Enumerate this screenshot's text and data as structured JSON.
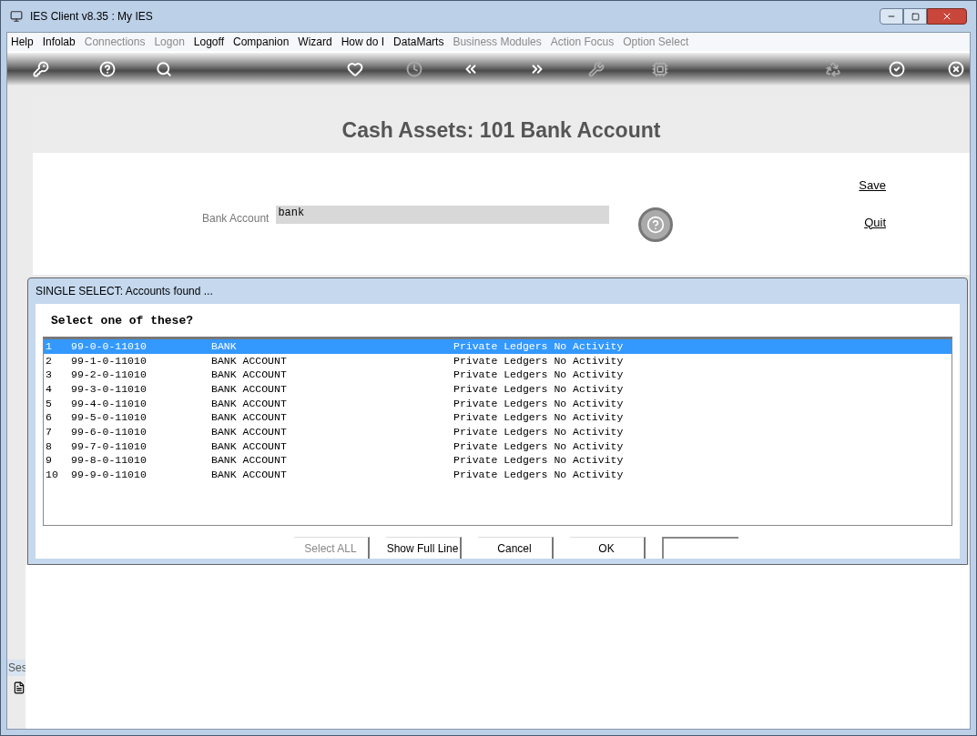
{
  "window": {
    "title": "IES Client v8.35 : My IES"
  },
  "menu": [
    {
      "label": "Help",
      "disabled": false
    },
    {
      "label": "Infolab",
      "disabled": false
    },
    {
      "label": "Connections",
      "disabled": true
    },
    {
      "label": "Logon",
      "disabled": true
    },
    {
      "label": "Logoff",
      "disabled": false
    },
    {
      "label": "Companion",
      "disabled": false
    },
    {
      "label": "Wizard",
      "disabled": false
    },
    {
      "label": "How do I",
      "disabled": false
    },
    {
      "label": "DataMarts",
      "disabled": false
    },
    {
      "label": "Business Modules",
      "disabled": true
    },
    {
      "label": "Action Focus",
      "disabled": true
    },
    {
      "label": "Option Select",
      "disabled": true
    }
  ],
  "toolbar": [
    {
      "kind": "key",
      "disabled": false
    },
    {
      "kind": "help",
      "disabled": false
    },
    {
      "kind": "search",
      "disabled": false
    },
    {
      "kind": "heart",
      "disabled": false
    },
    {
      "kind": "clock",
      "disabled": true
    },
    {
      "kind": "back",
      "disabled": false
    },
    {
      "kind": "forward",
      "disabled": false
    },
    {
      "kind": "tools",
      "disabled": true
    },
    {
      "kind": "chip",
      "disabled": true
    },
    {
      "kind": "recycle",
      "disabled": true
    },
    {
      "kind": "check",
      "disabled": false
    },
    {
      "kind": "close",
      "disabled": false
    }
  ],
  "form": {
    "title": "Cash Assets: 101 Bank Account",
    "field_label": "Bank Account",
    "field_value": "bank",
    "links": [
      "Save",
      "Quit"
    ]
  },
  "dialog": {
    "title": "SINGLE SELECT: Accounts found  ...",
    "prompt": "Select one of these?",
    "rows": [
      {
        "num": "1",
        "code": "99-0-0-11010",
        "name": "BANK",
        "status": "Private Ledgers No Activity",
        "selected": true
      },
      {
        "num": "2",
        "code": "99-1-0-11010",
        "name": "BANK ACCOUNT",
        "status": "Private Ledgers No Activity",
        "selected": false
      },
      {
        "num": "3",
        "code": "99-2-0-11010",
        "name": "BANK ACCOUNT",
        "status": "Private Ledgers No Activity",
        "selected": false
      },
      {
        "num": "4",
        "code": "99-3-0-11010",
        "name": "BANK ACCOUNT",
        "status": "Private Ledgers No Activity",
        "selected": false
      },
      {
        "num": "5",
        "code": "99-4-0-11010",
        "name": "BANK ACCOUNT",
        "status": "Private Ledgers No Activity",
        "selected": false
      },
      {
        "num": "6",
        "code": "99-5-0-11010",
        "name": "BANK ACCOUNT",
        "status": "Private Ledgers No Activity",
        "selected": false
      },
      {
        "num": "7",
        "code": "99-6-0-11010",
        "name": "BANK ACCOUNT",
        "status": "Private Ledgers No Activity",
        "selected": false
      },
      {
        "num": "8",
        "code": "99-7-0-11010",
        "name": "BANK ACCOUNT",
        "status": "Private Ledgers No Activity",
        "selected": false
      },
      {
        "num": "9",
        "code": "99-8-0-11010",
        "name": "BANK ACCOUNT",
        "status": "Private Ledgers No Activity",
        "selected": false
      },
      {
        "num": "10",
        "code": "99-9-0-11010",
        "name": "BANK ACCOUNT",
        "status": "Private Ledgers No Activity",
        "selected": false
      }
    ],
    "buttons": [
      {
        "label": "Select ALL",
        "disabled": true
      },
      {
        "label": "Show Full Line",
        "disabled": false
      },
      {
        "label": "Cancel",
        "disabled": false
      },
      {
        "label": "OK",
        "disabled": false
      }
    ]
  },
  "session_tab": "Ses"
}
